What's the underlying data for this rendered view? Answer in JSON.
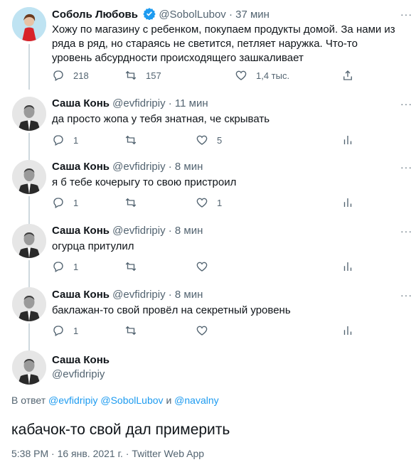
{
  "original": {
    "name": "Соболь Любовь",
    "handle": "@SobolLubov",
    "time": "37 мин",
    "text": "Хожу по магазину с ребенком, покупаем продукты домой. За нами из ряда в ряд, но стараясь не светится, петляет наружка. Что-то уровень абсурдности происходящего зашкаливает",
    "replies": "218",
    "retweets": "157",
    "likes": "1,4 тыс."
  },
  "replies": [
    {
      "name": "Саша Конь",
      "handle": "@evfidripiy",
      "time": "11 мин",
      "text": "да просто жопа у тебя знатная, че скрывать",
      "replies": "1",
      "retweets": "",
      "likes": "5"
    },
    {
      "name": "Саша Конь",
      "handle": "@evfidripiy",
      "time": "8 мин",
      "text": "я б тебе кочерыгу то свою пристроил",
      "replies": "1",
      "retweets": "",
      "likes": "1"
    },
    {
      "name": "Саша Конь",
      "handle": "@evfidripiy",
      "time": "8 мин",
      "text": "огурца притулил",
      "replies": "1",
      "retweets": "",
      "likes": ""
    },
    {
      "name": "Саша Конь",
      "handle": "@evfidripiy",
      "time": "8 мин",
      "text": "баклажан-то свой провёл на секретный уровень",
      "replies": "1",
      "retweets": "",
      "likes": ""
    }
  ],
  "focus": {
    "name": "Саша Конь",
    "handle": "@evfidripiy",
    "replying_prefix": "В ответ",
    "mention1": "@evfidripiy",
    "mention2": "@SobolLubov",
    "and": "и",
    "mention3": "@navalny",
    "text": "кабачок-то свой дал примерить",
    "meta": "5:38 PM · 16 янв. 2021 г. · Twitter Web App"
  },
  "ui": {
    "separator": "·",
    "more_icon": "···"
  },
  "icons": [
    "reply-icon",
    "retweet-icon",
    "like-icon",
    "share-icon",
    "analytics-icon",
    "more-icon",
    "verified-icon"
  ],
  "colors": {
    "text": "#0f1419",
    "secondary": "#536471",
    "accent": "#1d9bf0",
    "line": "#cfd9de"
  }
}
